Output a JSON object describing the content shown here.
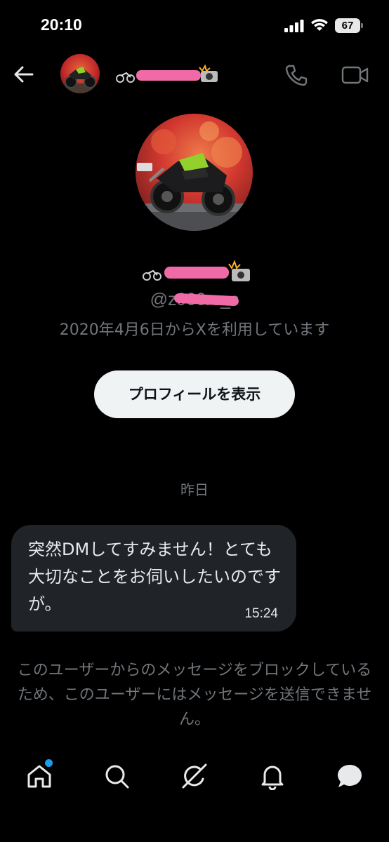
{
  "status_bar": {
    "time": "20:10",
    "battery_level": "67",
    "icons": [
      "cellular-signal-icon",
      "wifi-icon",
      "battery-icon"
    ]
  },
  "header": {
    "back_icon": "arrow-left-icon",
    "call_icon": "phone-icon",
    "video_icon": "video-camera-icon"
  },
  "profile": {
    "handle": "@z900rs_s",
    "joined": "2020年4月6日からXを利用しています",
    "view_profile_label": "プロフィールを表示"
  },
  "conversation": {
    "date_label": "昨日",
    "messages": [
      {
        "text": "突然DMしてすみません！とても大切なことをお伺いしたいのですが。",
        "time": "15:24"
      }
    ],
    "blocked_notice": "このユーザーからのメッセージをブロックしているため、このユーザーにはメッセージを送信できません。"
  },
  "bottom_nav": {
    "items": [
      "home-icon",
      "search-icon",
      "grok-icon",
      "notifications-icon",
      "messages-icon"
    ],
    "home_has_notification": true
  },
  "colors": {
    "background": "#000000",
    "accent_blue": "#1d9bf0",
    "muted_text": "#71767b",
    "bubble_bg": "#202327",
    "redaction_pink": "#f06aa8"
  }
}
